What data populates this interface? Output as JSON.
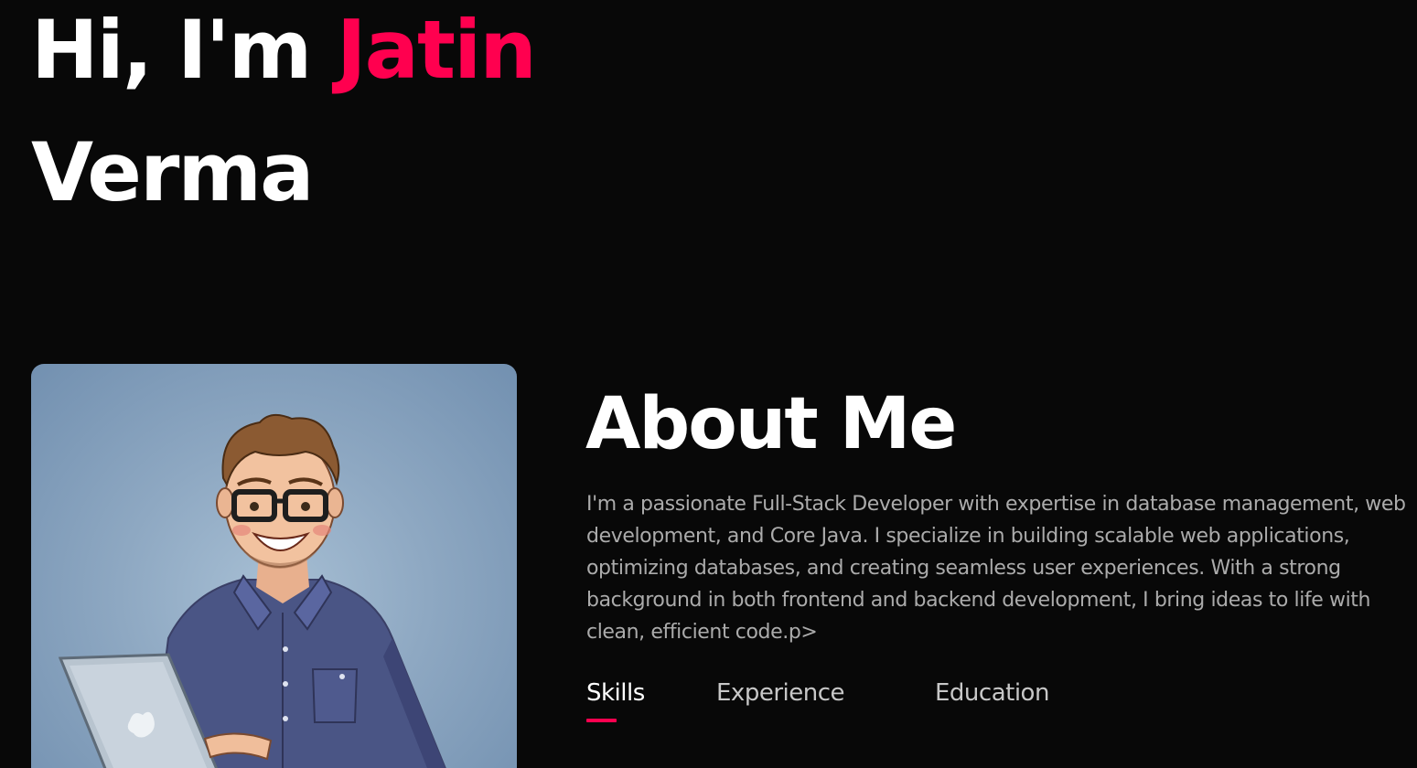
{
  "hero": {
    "greeting": "Hi, I'm",
    "first_name": "Jatin",
    "last_name": "Verma"
  },
  "portrait": {
    "icon": "developer-cartoon-portrait"
  },
  "about": {
    "title": "About Me",
    "text": "I'm a passionate Full-Stack Developer with expertise in database management, web development, and Core Java. I specialize in building scalable web applications, optimizing databases, and creating seamless user experiences. With a strong background in both frontend and backend development, I bring ideas to life with clean, efficient code.p>"
  },
  "tabs": [
    {
      "label": "Skills",
      "active": true
    },
    {
      "label": "Experience",
      "active": false
    },
    {
      "label": "Education",
      "active": false
    }
  ],
  "colors": {
    "background": "#080808",
    "accent": "#ff004f",
    "muted_text": "#ababab"
  }
}
